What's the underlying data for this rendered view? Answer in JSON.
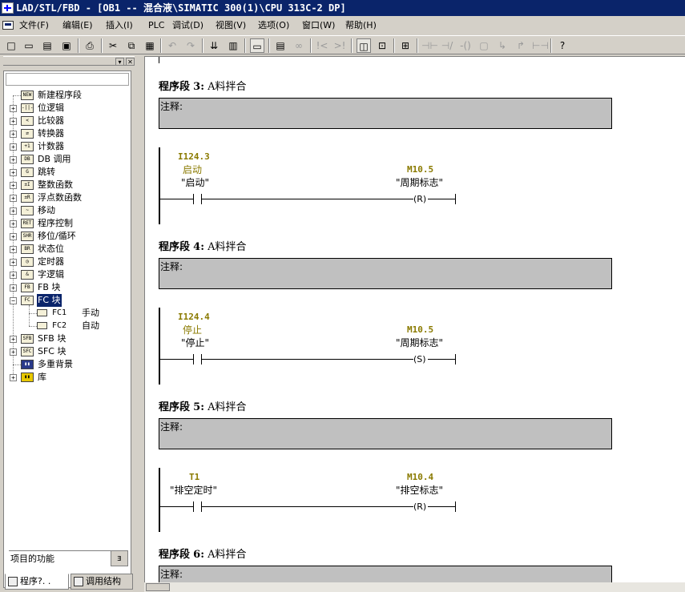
{
  "window": {
    "title": "LAD/STL/FBD  - [OB1 -- 混合液\\SIMATIC 300(1)\\CPU 313C-2 DP]"
  },
  "menu": [
    {
      "label": "文件(F)"
    },
    {
      "label": "编辑(E)"
    },
    {
      "label": "插入(I)"
    },
    {
      "label": "PLC"
    },
    {
      "label": "调试(D)"
    },
    {
      "label": "视图(V)"
    },
    {
      "label": "选项(O)"
    },
    {
      "label": "窗口(W)"
    },
    {
      "label": "帮助(H)"
    }
  ],
  "tree": {
    "items": [
      {
        "label": "新建程序段",
        "icon": "new-network-icon"
      },
      {
        "label": "位逻辑",
        "icon": "bit-logic-icon"
      },
      {
        "label": "比较器",
        "icon": "comparator-icon"
      },
      {
        "label": "转换器",
        "icon": "converter-icon"
      },
      {
        "label": "计数器",
        "icon": "counter-icon"
      },
      {
        "label": "DB 调用",
        "icon": "db-call-icon"
      },
      {
        "label": "跳转",
        "icon": "jump-icon"
      },
      {
        "label": "整数函数",
        "icon": "integer-function-icon"
      },
      {
        "label": "浮点数函数",
        "icon": "float-function-icon"
      },
      {
        "label": "移动",
        "icon": "move-icon"
      },
      {
        "label": "程序控制",
        "icon": "program-control-icon"
      },
      {
        "label": "移位/循环",
        "icon": "shift-rotate-icon"
      },
      {
        "label": "状态位",
        "icon": "status-bit-icon"
      },
      {
        "label": "定时器",
        "icon": "timer-icon"
      },
      {
        "label": "字逻辑",
        "icon": "word-logic-icon"
      },
      {
        "label": "FB 块",
        "icon": "fb-block-icon"
      },
      {
        "label": "FC 块",
        "icon": "fc-block-icon"
      },
      {
        "label": "FC1",
        "extra": "手动",
        "icon": "fc-item-icon"
      },
      {
        "label": "FC2",
        "extra": "自动",
        "icon": "fc-item-icon"
      },
      {
        "label": "SFB 块",
        "icon": "sfb-block-icon"
      },
      {
        "label": "SFC 块",
        "icon": "sfc-block-icon"
      },
      {
        "label": "多重背景",
        "icon": "multi-instance-icon"
      },
      {
        "label": "库",
        "icon": "library-icon"
      }
    ]
  },
  "left_footer": {
    "function_label": "项目的功能",
    "tab_program": "程序?. .",
    "tab_call_structure": "调用结构"
  },
  "networks": [
    {
      "number": "3",
      "title": "A料拌合",
      "comment_label": "注释:",
      "contact": {
        "address": "I124.3",
        "comment": "启动",
        "symbol": "\"启动\""
      },
      "coil": {
        "address": "M10.5",
        "symbol": "\"周期标志\"",
        "type": "(R)"
      }
    },
    {
      "number": "4",
      "title": "A料拌合",
      "comment_label": "注释:",
      "contact": {
        "address": "I124.4",
        "comment": "停止",
        "symbol": "\"停止\""
      },
      "coil": {
        "address": "M10.5",
        "symbol": "\"周期标志\"",
        "type": "(S)"
      }
    },
    {
      "number": "5",
      "title": "A料拌合",
      "comment_label": "注释:",
      "contact": {
        "address": "T1",
        "comment": "",
        "symbol": "\"排空定时\""
      },
      "coil": {
        "address": "M10.4",
        "symbol": "\"排空标志\"",
        "type": "(R)"
      }
    },
    {
      "number": "6",
      "title": "A料拌合",
      "comment_label": "注释:"
    }
  ],
  "labels": {
    "network_prefix": "程序段"
  }
}
